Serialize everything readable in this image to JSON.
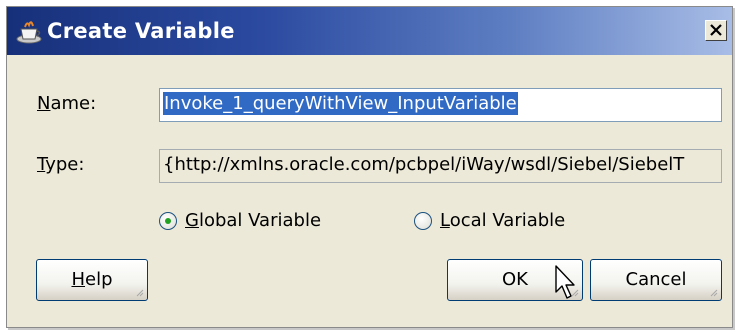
{
  "window": {
    "title": "Create Variable",
    "close_label": "Close"
  },
  "form": {
    "name_label_ul": "N",
    "name_label_rest": "ame:",
    "name_value": "Invoke_1_queryWithView_InputVariable",
    "type_label_ul": "T",
    "type_label_rest": "ype:",
    "type_value": "{http://xmlns.oracle.com/pcbpel/iWay/wsdl/Siebel/SiebelT"
  },
  "scope": {
    "global_ul": "G",
    "global_rest": "lobal Variable",
    "global_selected": true,
    "local_ul": "L",
    "local_rest": "ocal Variable",
    "local_selected": false
  },
  "buttons": {
    "help_ul": "H",
    "help_rest": "elp",
    "ok": "OK",
    "cancel": "Cancel"
  },
  "colors": {
    "titlebar_start": "#17307a",
    "titlebar_end": "#a8bde6",
    "selection": "#316ac5",
    "dialog_bg": "#ece9d8"
  }
}
